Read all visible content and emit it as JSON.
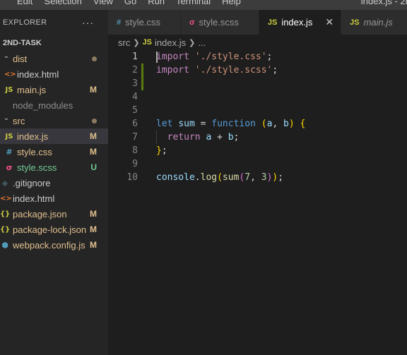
{
  "menubar": {
    "items": [
      "Edit",
      "Selection",
      "View",
      "Go",
      "Run",
      "Terminal",
      "Help"
    ],
    "window_title": "index.js - 2r"
  },
  "explorer": {
    "title": "EXPLORER",
    "more_icon": "ellipsis-icon",
    "project": "2ND-TASK",
    "items": [
      {
        "label": "dist",
        "type": "folder",
        "indent": 0,
        "status": "dot",
        "color": "#e2c08d"
      },
      {
        "label": "index.html",
        "type": "html",
        "indent": 1,
        "status": "",
        "color": "#cccccc"
      },
      {
        "label": "main.js",
        "type": "js",
        "indent": 1,
        "status": "M",
        "color": "#e2c08d"
      },
      {
        "label": "node_modules",
        "type": "folder-closed",
        "indent": 0,
        "status": "",
        "color": "#8c8c8c"
      },
      {
        "label": "src",
        "type": "folder",
        "indent": 0,
        "status": "dot",
        "color": "#e2c08d"
      },
      {
        "label": "index.js",
        "type": "js",
        "indent": 1,
        "status": "M",
        "color": "#e2c08d",
        "selected": true
      },
      {
        "label": "style.css",
        "type": "css",
        "indent": 1,
        "status": "M",
        "color": "#e2c08d"
      },
      {
        "label": "style.scss",
        "type": "scss",
        "indent": 1,
        "status": "U",
        "color": "#73c991"
      },
      {
        "label": ".gitignore",
        "type": "git",
        "indent": 0,
        "status": "",
        "color": "#cccccc"
      },
      {
        "label": "index.html",
        "type": "html",
        "indent": 0,
        "status": "",
        "color": "#cccccc"
      },
      {
        "label": "package.json",
        "type": "json",
        "indent": 0,
        "status": "M",
        "color": "#e2c08d"
      },
      {
        "label": "package-lock.json",
        "type": "json",
        "indent": 0,
        "status": "M",
        "color": "#e2c08d"
      },
      {
        "label": "webpack.config.js",
        "type": "webpack",
        "indent": 0,
        "status": "M",
        "color": "#e2c08d"
      }
    ]
  },
  "tabs": [
    {
      "label": "style.css",
      "icon": "#",
      "icon_color": "#519aba",
      "active": false,
      "italic": false
    },
    {
      "label": "style.scss",
      "icon": "σ",
      "icon_color": "#f55385",
      "active": false,
      "italic": false
    },
    {
      "label": "index.js",
      "icon": "JS",
      "icon_color": "#cbcb41",
      "active": true,
      "italic": false,
      "close": "✕"
    },
    {
      "label": "main.js",
      "icon": "JS",
      "icon_color": "#cbcb41",
      "active": false,
      "italic": true
    }
  ],
  "breadcrumb": {
    "folder": "src",
    "file_icon": "JS",
    "file": "index.js",
    "more": "..."
  },
  "editor": {
    "current_line": 1,
    "modified_lines": [
      1,
      3
    ],
    "lines": [
      [
        {
          "t": "import",
          "c": "ctl"
        },
        {
          "t": " ",
          "c": "pn"
        },
        {
          "t": "'./style.css'",
          "c": "str"
        },
        {
          "t": ";",
          "c": "pn"
        }
      ],
      [
        {
          "t": "import",
          "c": "ctl"
        },
        {
          "t": " ",
          "c": "pn"
        },
        {
          "t": "'./style.scss'",
          "c": "str"
        },
        {
          "t": ";",
          "c": "pn"
        }
      ],
      [],
      [],
      [],
      [
        {
          "t": "let",
          "c": "kw"
        },
        {
          "t": " ",
          "c": "pn"
        },
        {
          "t": "sum",
          "c": "id"
        },
        {
          "t": " = ",
          "c": "pn"
        },
        {
          "t": "function",
          "c": "kw"
        },
        {
          "t": " ",
          "c": "pn"
        },
        {
          "t": "(",
          "c": "br1"
        },
        {
          "t": "a",
          "c": "id"
        },
        {
          "t": ", ",
          "c": "pn"
        },
        {
          "t": "b",
          "c": "id"
        },
        {
          "t": ")",
          "c": "br1"
        },
        {
          "t": " ",
          "c": "pn"
        },
        {
          "t": "{",
          "c": "br1"
        }
      ],
      [
        {
          "t": "  ",
          "c": "pn"
        },
        {
          "t": "return",
          "c": "ctl"
        },
        {
          "t": " ",
          "c": "pn"
        },
        {
          "t": "a",
          "c": "id"
        },
        {
          "t": " + ",
          "c": "pn"
        },
        {
          "t": "b",
          "c": "id"
        },
        {
          "t": ";",
          "c": "pn"
        }
      ],
      [
        {
          "t": "}",
          "c": "br1"
        },
        {
          "t": ";",
          "c": "pn"
        }
      ],
      [],
      [
        {
          "t": "console",
          "c": "id"
        },
        {
          "t": ".",
          "c": "pn"
        },
        {
          "t": "log",
          "c": "fn"
        },
        {
          "t": "(",
          "c": "br1"
        },
        {
          "t": "sum",
          "c": "fn"
        },
        {
          "t": "(",
          "c": "br2"
        },
        {
          "t": "7",
          "c": "num"
        },
        {
          "t": ", ",
          "c": "pn"
        },
        {
          "t": "3",
          "c": "num"
        },
        {
          "t": ")",
          "c": "br2"
        },
        {
          "t": ")",
          "c": "br1"
        },
        {
          "t": ";",
          "c": "pn"
        }
      ]
    ]
  }
}
